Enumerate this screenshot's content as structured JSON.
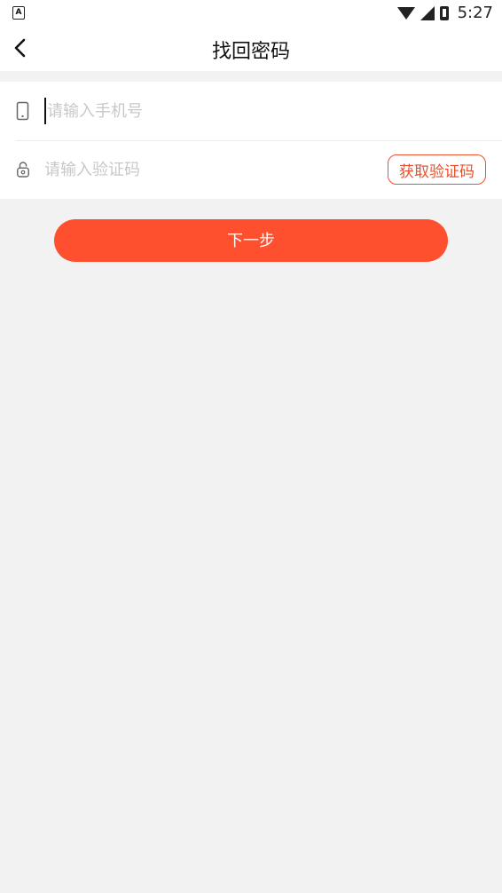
{
  "status_bar": {
    "notification_icon_label": "A",
    "time": "5:27",
    "icons": [
      "wifi-icon",
      "signal-icon",
      "battery-icon"
    ]
  },
  "header": {
    "title": "找回密码",
    "back_icon": "chevron-left-icon"
  },
  "form": {
    "phone": {
      "icon": "phone-icon",
      "placeholder": "请输入手机号",
      "value": ""
    },
    "code": {
      "icon": "lock-icon",
      "placeholder": "请输入验证码",
      "value": "",
      "get_code_label": "获取验证码"
    }
  },
  "actions": {
    "next_label": "下一步"
  },
  "colors": {
    "accent": "#fe4f2e",
    "background": "#f2f2f2",
    "card": "#ffffff"
  }
}
